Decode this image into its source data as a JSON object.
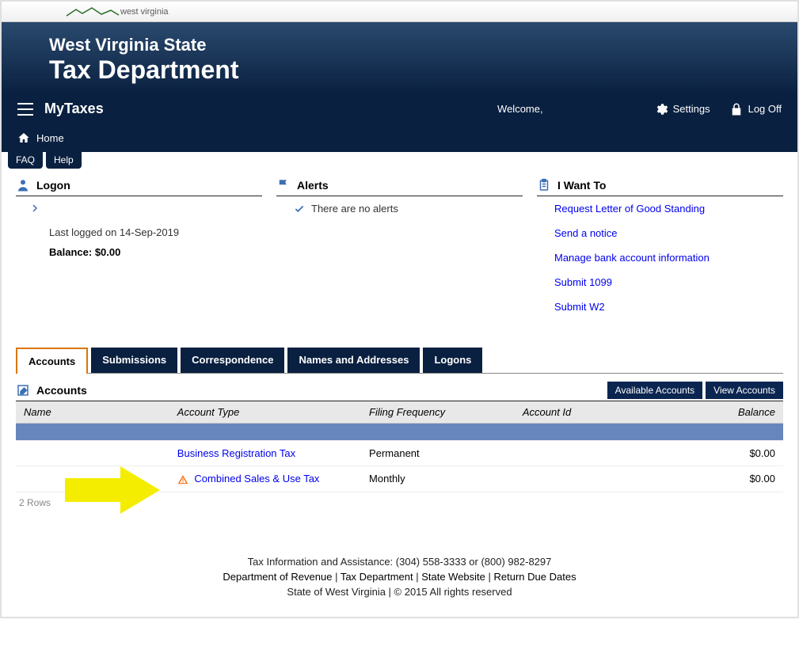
{
  "logo_text": "west virginia",
  "header": {
    "line1": "West Virginia State",
    "line2": "Tax Department"
  },
  "nav": {
    "mytaxes": "MyTaxes",
    "welcome": "Welcome,",
    "settings": "Settings",
    "logoff": "Log Off"
  },
  "breadcrumb": {
    "home": "Home"
  },
  "help_tabs": {
    "faq": "FAQ",
    "help": "Help"
  },
  "panels": {
    "logon": {
      "title": "Logon",
      "last_logged": "Last logged on 14-Sep-2019",
      "balance_label": "Balance:",
      "balance_value": "$0.00"
    },
    "alerts": {
      "title": "Alerts",
      "none": "There are no alerts"
    },
    "iwantto": {
      "title": "I Want To",
      "links": [
        "Request Letter of Good Standing",
        "Send a notice",
        "Manage bank account information",
        "Submit 1099",
        "Submit W2"
      ]
    }
  },
  "tabs": [
    "Accounts",
    "Submissions",
    "Correspondence",
    "Names and Addresses",
    "Logons"
  ],
  "accounts_section": {
    "title": "Accounts",
    "buttons": [
      "Available Accounts",
      "View Accounts"
    ],
    "columns": [
      "Name",
      "Account Type",
      "Filing Frequency",
      "Account Id",
      "Balance"
    ],
    "rows": [
      {
        "name": "",
        "type": "Business Registration Tax",
        "freq": "Permanent",
        "id": "",
        "bal": "$0.00",
        "warn": false
      },
      {
        "name": "",
        "type": "Combined Sales & Use Tax",
        "freq": "Monthly",
        "id": "",
        "bal": "$0.00",
        "warn": true
      }
    ],
    "row_count": "2 Rows"
  },
  "footer": {
    "line1": "Tax Information and Assistance: (304) 558-3333 or (800) 982-8297",
    "line2_parts": [
      "Department of Revenue",
      "Tax Department",
      "State Website",
      "Return Due Dates"
    ],
    "line3": "State of West Virginia | © 2015 All rights reserved"
  }
}
